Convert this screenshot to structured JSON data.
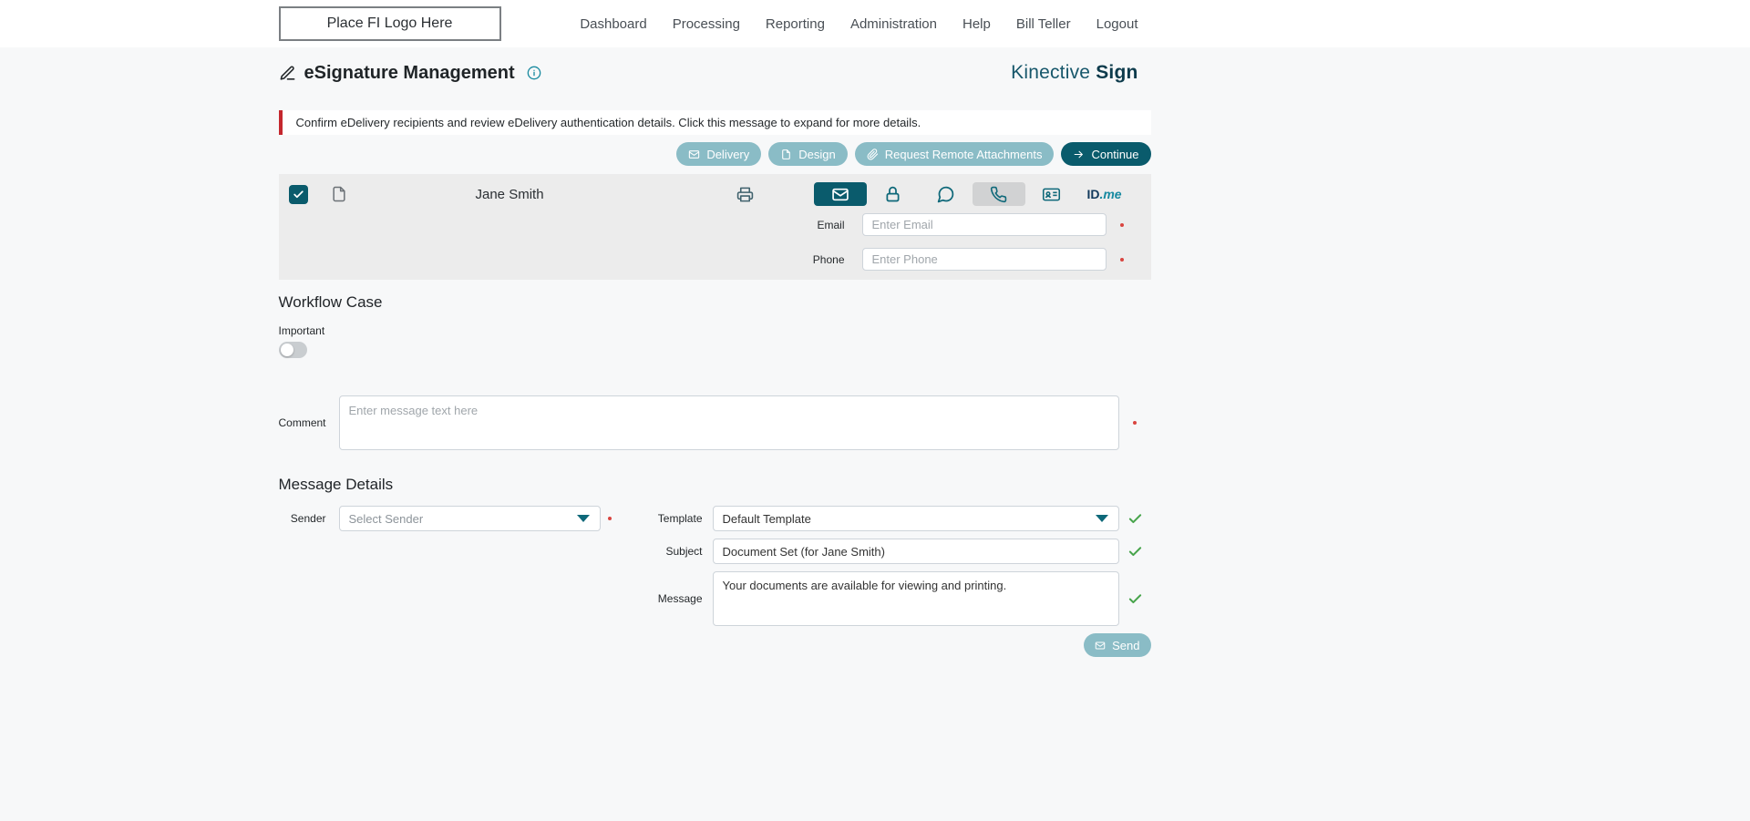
{
  "navbar": {
    "logo_text": "Place FI Logo Here",
    "items": [
      {
        "label": "Dashboard"
      },
      {
        "label": "Processing"
      },
      {
        "label": "Reporting"
      },
      {
        "label": "Administration"
      },
      {
        "label": "Help"
      },
      {
        "label": "Bill Teller"
      },
      {
        "label": "Logout"
      }
    ]
  },
  "header": {
    "title": "eSignature Management",
    "brand": {
      "name": "Kinective",
      "product": "Sign"
    }
  },
  "alert": {
    "text": "Confirm eDelivery recipients and review eDelivery authentication details. Click this message to expand for more details."
  },
  "toolbar": {
    "delivery_label": "Delivery",
    "design_label": "Design",
    "attachments_label": "Request Remote Attachments",
    "continue_label": "Continue"
  },
  "recipient": {
    "name": "Jane Smith",
    "email_label": "Email",
    "email_placeholder": "Enter Email",
    "phone_label": "Phone",
    "phone_placeholder": "Enter Phone",
    "idme_id": "ID",
    "idme_me": ".me"
  },
  "workflow_case": {
    "heading": "Workflow Case",
    "important_label": "Important",
    "important_state": "off",
    "comment_label": "Comment",
    "comment_placeholder": "Enter message text here"
  },
  "message_details": {
    "heading": "Message Details",
    "sender_label": "Sender",
    "sender_value": "Select Sender",
    "template_label": "Template",
    "template_value": "Default Template",
    "subject_label": "Subject",
    "subject_value": "Document Set (for Jane Smith)",
    "message_label": "Message",
    "message_value": "Your documents are available for viewing and printing.",
    "send_label": "Send"
  },
  "icons": {
    "pen-icon": "pen outline",
    "info-icon": "circled i",
    "envelope-icon": "✉",
    "file-icon": "document with folded corner",
    "paperclip-icon": "paperclip",
    "arrow-right-icon": "→",
    "checkbox-check-icon": "✓",
    "printer-icon": "printer outline",
    "lock-icon": "padlock",
    "chat-icon": "speech bubble",
    "phone-icon": "handset",
    "id-card-icon": "id badge",
    "chevron-down-icon": "▼",
    "check-icon": "✓"
  },
  "colors": {
    "primary_teal": "#0a5b6c",
    "muted_teal": "#8abcc6",
    "icon_teal": "#0e6879",
    "alert_red": "#c4272e",
    "required_red": "#d9453f",
    "success_green": "#47a44b",
    "panel_gray": "#ececec",
    "page_bg": "#f7f8f9"
  }
}
